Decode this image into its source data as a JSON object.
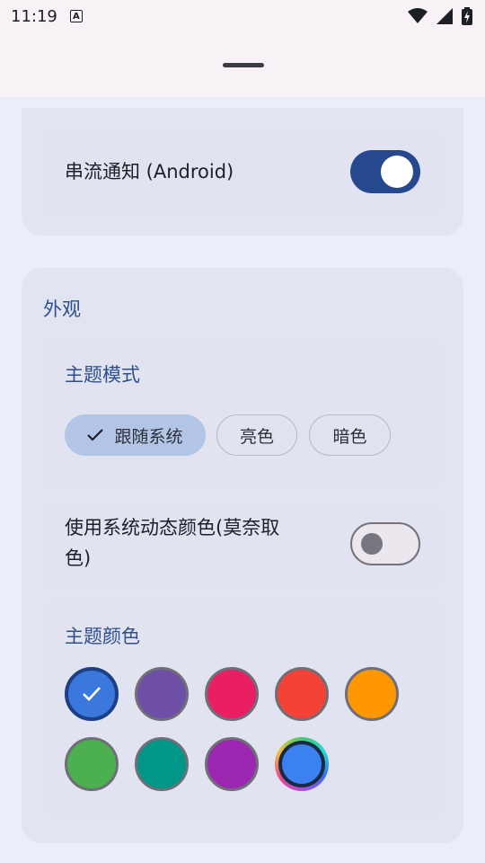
{
  "status_bar": {
    "time": "11:19",
    "notification_icon": "A"
  },
  "stream_notify": {
    "label": "串流通知 (Android)",
    "enabled": true
  },
  "appearance": {
    "title": "外观",
    "theme_mode": {
      "title": "主题模式",
      "options": [
        "跟随系统",
        "亮色",
        "暗色"
      ],
      "selected": "跟随系统"
    },
    "dynamic_color": {
      "label_line1": "使用系统动态颜色(莫奈取",
      "label_line2": "色)",
      "enabled": false
    },
    "theme_color": {
      "title": "主题颜色",
      "colors": [
        "#3b78dc",
        "#6d4fa6",
        "#e91e63",
        "#f44336",
        "#ff9800",
        "#4caf50",
        "#009688",
        "#9c27b0",
        "custom"
      ],
      "selected_index": 0
    }
  }
}
